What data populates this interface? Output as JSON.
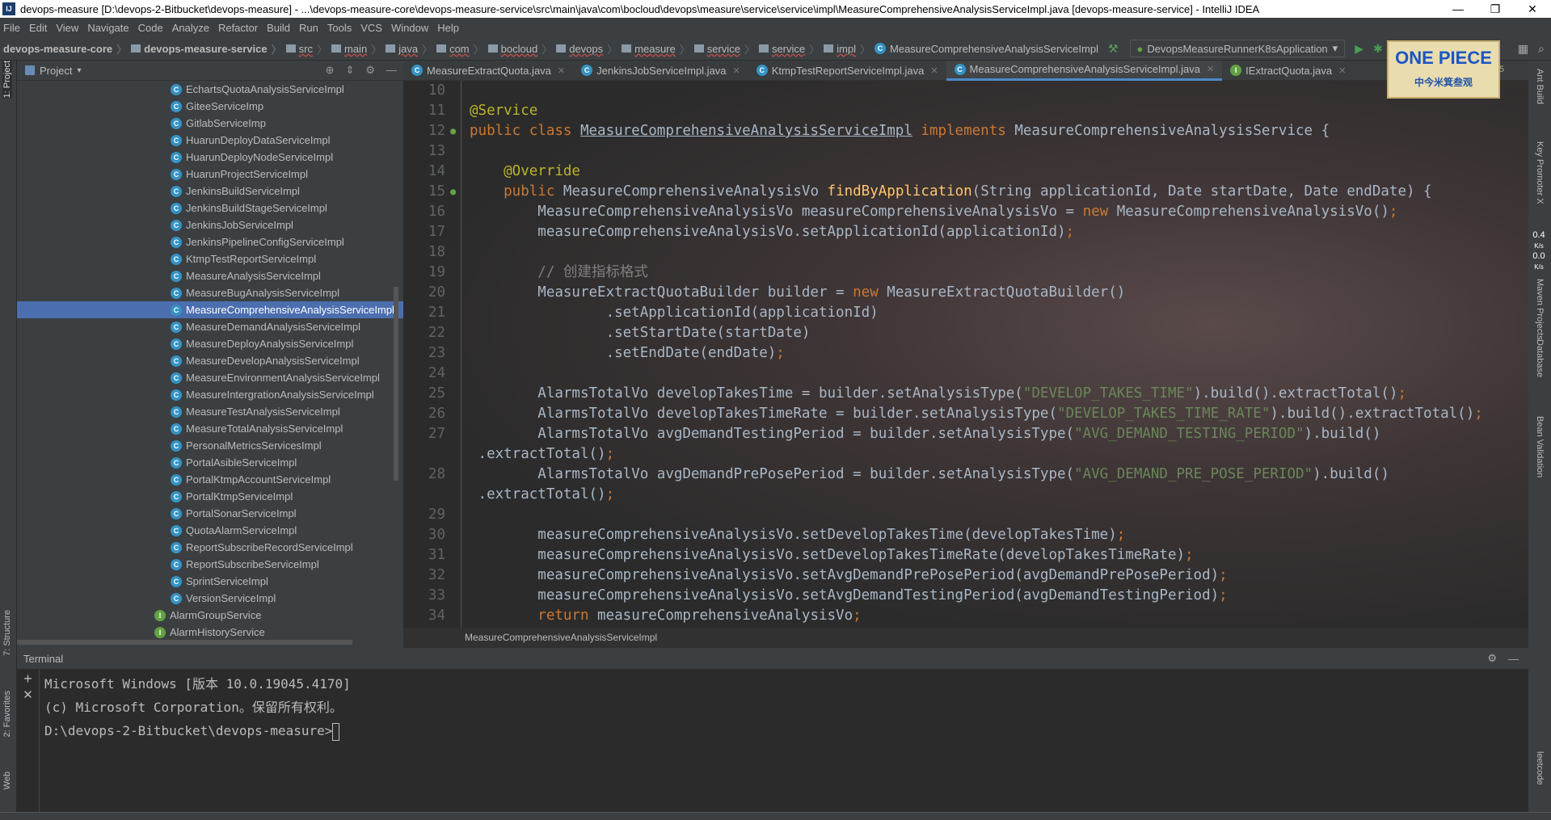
{
  "window": {
    "title": "devops-measure [D:\\devops-2-Bitbucket\\devops-measure] - ...\\devops-measure-core\\devops-measure-service\\src\\main\\java\\com\\bocloud\\devops\\measure\\service\\service\\impl\\MeasureComprehensiveAnalysisServiceImpl.java [devops-measure-service] - IntelliJ IDEA",
    "logo": "IJ",
    "minimize": "—",
    "maximize": "❐",
    "close": "✕"
  },
  "menu": [
    "File",
    "Edit",
    "View",
    "Navigate",
    "Code",
    "Analyze",
    "Refactor",
    "Build",
    "Run",
    "Tools",
    "VCS",
    "Window",
    "Help"
  ],
  "breadcrumbs": [
    "devops-measure-core",
    "devops-measure-service",
    "src",
    "main",
    "java",
    "com",
    "bocloud",
    "devops",
    "measure",
    "service",
    "service",
    "impl",
    "MeasureComprehensiveAnalysisServiceImpl"
  ],
  "run_config": "DevopsMeasureRunnerK8sApplication",
  "project": {
    "title": "Project",
    "items": [
      {
        "label": "EchartsQuotaAnalysisServiceImpl",
        "kind": "C"
      },
      {
        "label": "GiteeServiceImp",
        "kind": "C"
      },
      {
        "label": "GitlabServiceImp",
        "kind": "C"
      },
      {
        "label": "HuarunDeployDataServiceImpl",
        "kind": "C"
      },
      {
        "label": "HuarunDeployNodeServiceImpl",
        "kind": "C"
      },
      {
        "label": "HuarunProjectServiceImpl",
        "kind": "C"
      },
      {
        "label": "JenkinsBuildServiceImpl",
        "kind": "C"
      },
      {
        "label": "JenkinsBuildStageServiceImpl",
        "kind": "C"
      },
      {
        "label": "JenkinsJobServiceImpl",
        "kind": "C"
      },
      {
        "label": "JenkinsPipelineConfigServiceImpl",
        "kind": "C"
      },
      {
        "label": "KtmpTestReportServiceImpl",
        "kind": "C"
      },
      {
        "label": "MeasureAnalysisServiceImpl",
        "kind": "C"
      },
      {
        "label": "MeasureBugAnalysisServiceImpl",
        "kind": "C"
      },
      {
        "label": "MeasureComprehensiveAnalysisServiceImpl",
        "kind": "C",
        "selected": true
      },
      {
        "label": "MeasureDemandAnalysisServiceImpl",
        "kind": "C"
      },
      {
        "label": "MeasureDeployAnalysisServiceImpl",
        "kind": "C"
      },
      {
        "label": "MeasureDevelopAnalysisServiceImpl",
        "kind": "C"
      },
      {
        "label": "MeasureEnvironmentAnalysisServiceImpl",
        "kind": "C"
      },
      {
        "label": "MeasureIntergrationAnalysisServiceImpl",
        "kind": "C"
      },
      {
        "label": "MeasureTestAnalysisServiceImpl",
        "kind": "C"
      },
      {
        "label": "MeasureTotalAnalysisServiceImpl",
        "kind": "C"
      },
      {
        "label": "PersonalMetricsServicesImpl",
        "kind": "C"
      },
      {
        "label": "PortalAsibleServiceImpl",
        "kind": "C"
      },
      {
        "label": "PortalKtmpAccountServiceImpl",
        "kind": "C"
      },
      {
        "label": "PortalKtmpServiceImpl",
        "kind": "C"
      },
      {
        "label": "PortalSonarServiceImpl",
        "kind": "C"
      },
      {
        "label": "QuotaAlarmServiceImpl",
        "kind": "C"
      },
      {
        "label": "ReportSubscribeRecordServiceImpl",
        "kind": "C"
      },
      {
        "label": "ReportSubscribeServiceImpl",
        "kind": "C"
      },
      {
        "label": "SprintServiceImpl",
        "kind": "C"
      },
      {
        "label": "VersionServiceImpl",
        "kind": "C"
      },
      {
        "label": "AlarmGroupService",
        "kind": "I"
      },
      {
        "label": "AlarmHistoryService",
        "kind": "I"
      }
    ]
  },
  "editor": {
    "tabs": [
      {
        "label": "MeasureExtractQuota.java",
        "kind": "C"
      },
      {
        "label": "JenkinsJobServiceImpl.java",
        "kind": "C"
      },
      {
        "label": "KtmpTestReportServiceImpl.java",
        "kind": "C"
      },
      {
        "label": "MeasureComprehensiveAnalysisServiceImpl.java",
        "kind": "C",
        "active": true
      },
      {
        "label": "IExtractQuota.java",
        "kind": "I"
      }
    ],
    "tab_overflow": "≡5",
    "breadcrumb": "MeasureComprehensiveAnalysisServiceImpl",
    "lines": [
      {
        "n": "10",
        "t": []
      },
      {
        "n": "11",
        "t": [
          [
            "an",
            "@Service"
          ]
        ]
      },
      {
        "n": "12",
        "t": [
          [
            "kw",
            "public class "
          ],
          [
            "cls",
            "MeasureComprehensiveAnalysisServiceImpl"
          ],
          [
            "kw",
            " implements "
          ],
          [
            "df",
            "MeasureComprehensiveAnalysisService {"
          ]
        ]
      },
      {
        "n": "13",
        "t": []
      },
      {
        "n": "14",
        "t": [
          [
            "an",
            "    @Override"
          ]
        ]
      },
      {
        "n": "15",
        "t": [
          [
            "kw",
            "    public "
          ],
          [
            "df",
            "MeasureComprehensiveAnalysisVo "
          ],
          [
            "fn",
            "findByApplication"
          ],
          [
            "df",
            "(String applicationId, Date startDate, Date endDate) {"
          ]
        ]
      },
      {
        "n": "16",
        "t": [
          [
            "df",
            "        MeasureComprehensiveAnalysisVo measureComprehensiveAnalysisVo = "
          ],
          [
            "kw",
            "new "
          ],
          [
            "df",
            "MeasureComprehensiveAnalysisVo()"
          ],
          [
            "kw",
            ";"
          ]
        ]
      },
      {
        "n": "17",
        "t": [
          [
            "df",
            "        measureComprehensiveAnalysisVo.setApplicationId(applicationId)"
          ],
          [
            "kw",
            ";"
          ]
        ]
      },
      {
        "n": "18",
        "t": []
      },
      {
        "n": "19",
        "t": [
          [
            "cm",
            "        // 创建指标格式"
          ]
        ]
      },
      {
        "n": "20",
        "t": [
          [
            "df",
            "        MeasureExtractQuotaBuilder builder = "
          ],
          [
            "kw",
            "new "
          ],
          [
            "df",
            "MeasureExtractQuotaBuilder()"
          ]
        ]
      },
      {
        "n": "21",
        "t": [
          [
            "df",
            "                .setApplicationId(applicationId)"
          ]
        ]
      },
      {
        "n": "22",
        "t": [
          [
            "df",
            "                .setStartDate(startDate)"
          ]
        ]
      },
      {
        "n": "23",
        "t": [
          [
            "df",
            "                .setEndDate(endDate)"
          ],
          [
            "kw",
            ";"
          ]
        ]
      },
      {
        "n": "24",
        "t": []
      },
      {
        "n": "25",
        "t": [
          [
            "df",
            "        AlarmsTotalVo developTakesTime = builder.setAnalysisType("
          ],
          [
            "str",
            "\"DEVELOP_TAKES_TIME\""
          ],
          [
            "df",
            ").build().extractTotal()"
          ],
          [
            "kw",
            ";"
          ]
        ]
      },
      {
        "n": "26",
        "t": [
          [
            "df",
            "        AlarmsTotalVo developTakesTimeRate = builder.setAnalysisType("
          ],
          [
            "str",
            "\"DEVELOP_TAKES_TIME_RATE\""
          ],
          [
            "df",
            ").build().extractTotal()"
          ],
          [
            "kw",
            ";"
          ]
        ]
      },
      {
        "n": "27",
        "t": [
          [
            "df",
            "        AlarmsTotalVo avgDemandTestingPeriod = builder.setAnalysisType("
          ],
          [
            "str",
            "\"AVG_DEMAND_TESTING_PERIOD\""
          ],
          [
            "df",
            ").build()"
          ]
        ]
      },
      {
        "n": "",
        "t": [
          [
            "df",
            " .extractTotal()"
          ],
          [
            "kw",
            ";"
          ]
        ]
      },
      {
        "n": "28",
        "t": [
          [
            "df",
            "        AlarmsTotalVo avgDemandPrePosePeriod = builder.setAnalysisType("
          ],
          [
            "str",
            "\"AVG_DEMAND_PRE_POSE_PERIOD\""
          ],
          [
            "df",
            ").build()"
          ]
        ]
      },
      {
        "n": "",
        "t": [
          [
            "df",
            " .extractTotal()"
          ],
          [
            "kw",
            ";"
          ]
        ]
      },
      {
        "n": "29",
        "t": []
      },
      {
        "n": "30",
        "t": [
          [
            "df",
            "        measureComprehensiveAnalysisVo.setDevelopTakesTime(developTakesTime)"
          ],
          [
            "kw",
            ";"
          ]
        ]
      },
      {
        "n": "31",
        "t": [
          [
            "df",
            "        measureComprehensiveAnalysisVo.setDevelopTakesTimeRate(developTakesTimeRate)"
          ],
          [
            "kw",
            ";"
          ]
        ]
      },
      {
        "n": "32",
        "t": [
          [
            "df",
            "        measureComprehensiveAnalysisVo.setAvgDemandPrePosePeriod(avgDemandPrePosePeriod)"
          ],
          [
            "kw",
            ";"
          ]
        ]
      },
      {
        "n": "33",
        "t": [
          [
            "df",
            "        measureComprehensiveAnalysisVo.setAvgDemandTestingPeriod(avgDemandTestingPeriod)"
          ],
          [
            "kw",
            ";"
          ]
        ]
      },
      {
        "n": "34",
        "t": [
          [
            "kw",
            "        return "
          ],
          [
            "df",
            "measureComprehensiveAnalysisVo"
          ],
          [
            "kw",
            ";"
          ]
        ]
      }
    ]
  },
  "banner": {
    "title": "ONE PIECE",
    "subtitle": "中今米箕叁观"
  },
  "terminal": {
    "title": "Terminal",
    "lines": [
      "Microsoft Windows [版本 10.0.19045.4170]",
      "(c) Microsoft Corporation。保留所有权利。",
      "",
      "D:\\devops-2-Bitbucket\\devops-measure>"
    ]
  },
  "left_tools": [
    "1: Project",
    "7: Structure",
    "2: Favorites",
    "Web"
  ],
  "right_tools": [
    "Ant Build",
    "Key Promoter X",
    "Maven Projects",
    "Database",
    "Bean Validation",
    "leetcode"
  ],
  "network": {
    "up": "0.4",
    "down": "0.0",
    "unit": "K/s"
  },
  "colors": {
    "keyword": "#cc7832",
    "method": "#ffc66d",
    "string": "#6a8759",
    "comment": "#808080",
    "annotation": "#bbb529",
    "text": "#a9b7c6",
    "selection": "#4b6eaf"
  }
}
